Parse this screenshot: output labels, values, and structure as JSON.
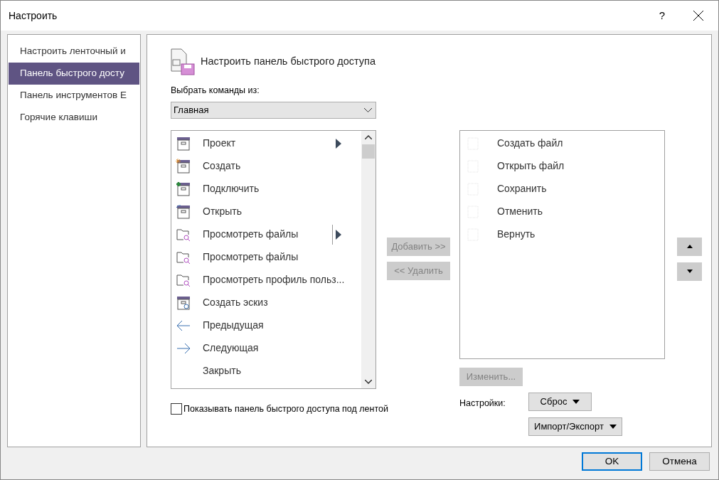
{
  "window": {
    "title": "Настроить",
    "help": "?"
  },
  "sidebar": {
    "items": [
      {
        "label": "Настроить ленточный и",
        "selected": false
      },
      {
        "label": "Панель быстрого досту",
        "selected": true
      },
      {
        "label": "Панель инструментов E",
        "selected": false
      },
      {
        "label": "Горячие клавиши",
        "selected": false
      }
    ]
  },
  "heading": "Настроить панель быстрого доступа",
  "choose_label": "Выбрать команды из:",
  "choose_select": {
    "value": "Главная"
  },
  "commands": [
    {
      "label": "Проект",
      "kind": "box",
      "submenu": true,
      "split": false
    },
    {
      "label": "Создать",
      "kind": "box-new"
    },
    {
      "label": "Подключить",
      "kind": "box-add"
    },
    {
      "label": "Открыть",
      "kind": "box-open"
    },
    {
      "label": "Просмотреть файлы",
      "kind": "folder-search",
      "submenu": true,
      "split": true
    },
    {
      "label": "Просмотреть файлы",
      "kind": "folder-search"
    },
    {
      "label": "Просмотреть профиль польз...",
      "kind": "folder-search"
    },
    {
      "label": "Создать эскиз",
      "kind": "box-photo"
    },
    {
      "label": "Предыдущая",
      "kind": "arrow-left"
    },
    {
      "label": "Следующая",
      "kind": "arrow-right"
    },
    {
      "label": "Закрыть",
      "kind": "none"
    }
  ],
  "add_button": {
    "label": "Добавить >>",
    "disabled": true
  },
  "remove_button": {
    "label": "<< Удалить",
    "disabled": true
  },
  "toolbar_items": [
    {
      "label": "Создать файл"
    },
    {
      "label": "Открыть файл"
    },
    {
      "label": "Сохранить"
    },
    {
      "label": "Отменить"
    },
    {
      "label": "Вернуть"
    }
  ],
  "change_button": {
    "label": "Изменить...",
    "disabled": true
  },
  "settings_label": "Настройки:",
  "reset_button": "Сброс",
  "import_export_button": "Импорт/Экспорт",
  "show_below_ribbon": {
    "label": "Показывать панель быстрого доступа под лентой",
    "checked": false
  },
  "ok_button": "OK",
  "cancel_button": "Отмена"
}
